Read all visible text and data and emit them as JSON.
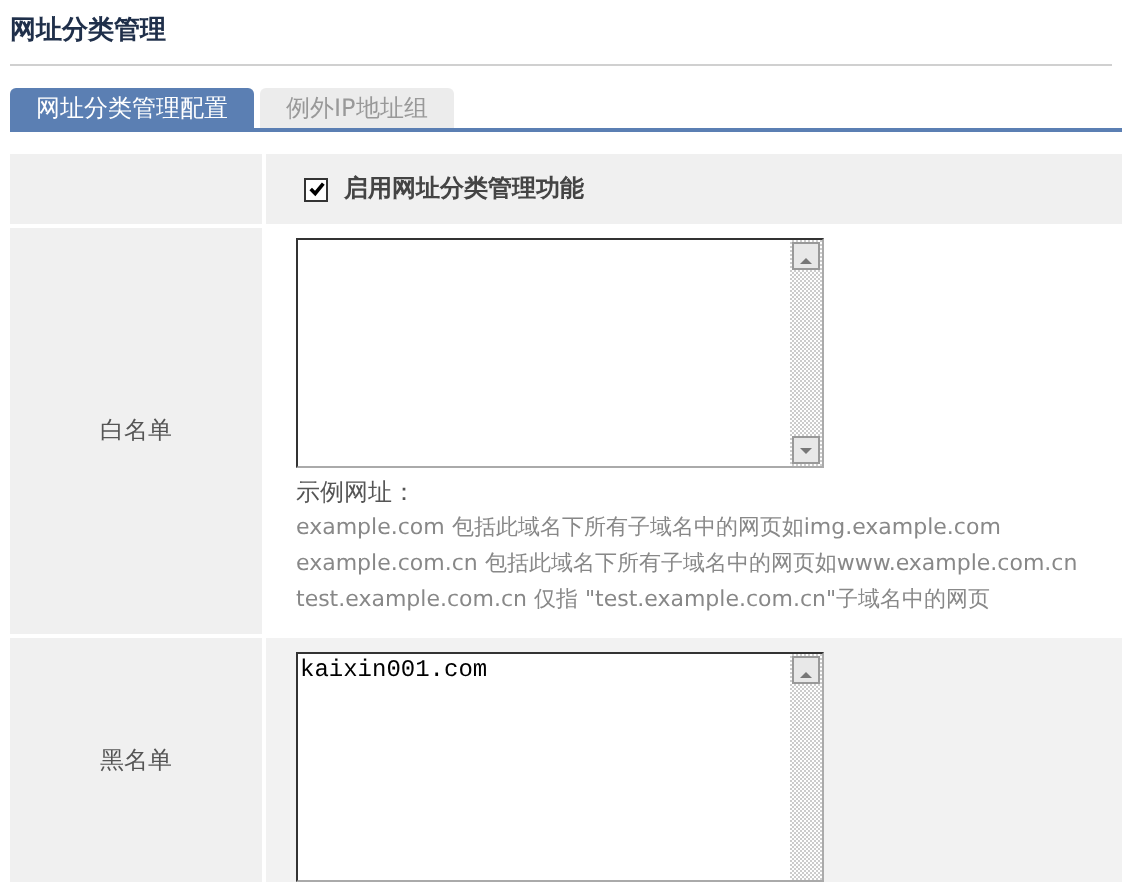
{
  "page": {
    "title": "网址分类管理"
  },
  "tabs": [
    {
      "label": "网址分类管理配置",
      "selected": true
    },
    {
      "label": "例外IP地址组",
      "selected": false
    }
  ],
  "enable": {
    "label": "启用网址分类管理功能",
    "checked": true
  },
  "whitelist": {
    "label": "白名单",
    "hint_title": "示例网址：",
    "hints": [
      "example.com 包括此域名下所有子域名中的网页如img.example.com",
      "example.com.cn 包括此域名下所有子域名中的网页如www.example.com.cn",
      "test.example.com.cn 仅指 \"test.example.com.cn\"子域名中的网页"
    ]
  },
  "blacklist": {
    "label": "黑名单",
    "value": "kaixin001.com"
  }
}
